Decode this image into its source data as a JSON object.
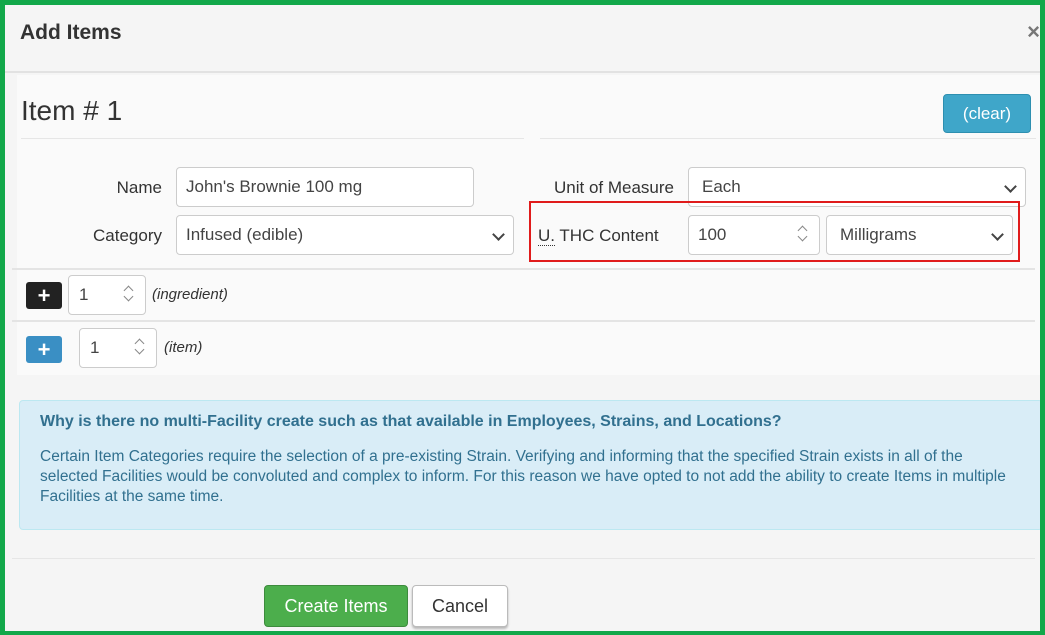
{
  "modal": {
    "title": "Add Items",
    "close_glyph": "×"
  },
  "item": {
    "heading": "Item # 1",
    "clear_label": "(clear)"
  },
  "form": {
    "name_label": "Name",
    "name_value": "John's Brownie 100 mg",
    "category_label": "Category",
    "category_value": "Infused (edible)",
    "uom_label": "Unit of Measure",
    "uom_value": "Each",
    "thc_label_abbr": "U.",
    "thc_label_rest": " THC Content",
    "thc_value": "100",
    "thc_unit_value": "Milligrams"
  },
  "ingredient_row": {
    "count": "1",
    "hint": "(ingredient)"
  },
  "item_row": {
    "count": "1",
    "hint": "(item)"
  },
  "info": {
    "title": "Why is there no multi-Facility create such as that available in Employees, Strains, and Locations?",
    "text": "Certain Item Categories require the selection of a pre-existing Strain. Verifying and informing that the specified Strain exists in all of the selected Facilities would be convoluted and complex to inform. For this reason we have opted to not add the ability to create Items in multiple Facilities at the same time."
  },
  "footer": {
    "create_label": "Create Items",
    "cancel_label": "Cancel"
  },
  "colors": {
    "frame": "#12a84a",
    "highlight": "#e01b1b",
    "primary_info": "#3fa6c9",
    "success": "#4cae4c"
  },
  "icons": [
    "close-icon",
    "chevron-down-icon",
    "spinner-icon",
    "plus-icon"
  ]
}
